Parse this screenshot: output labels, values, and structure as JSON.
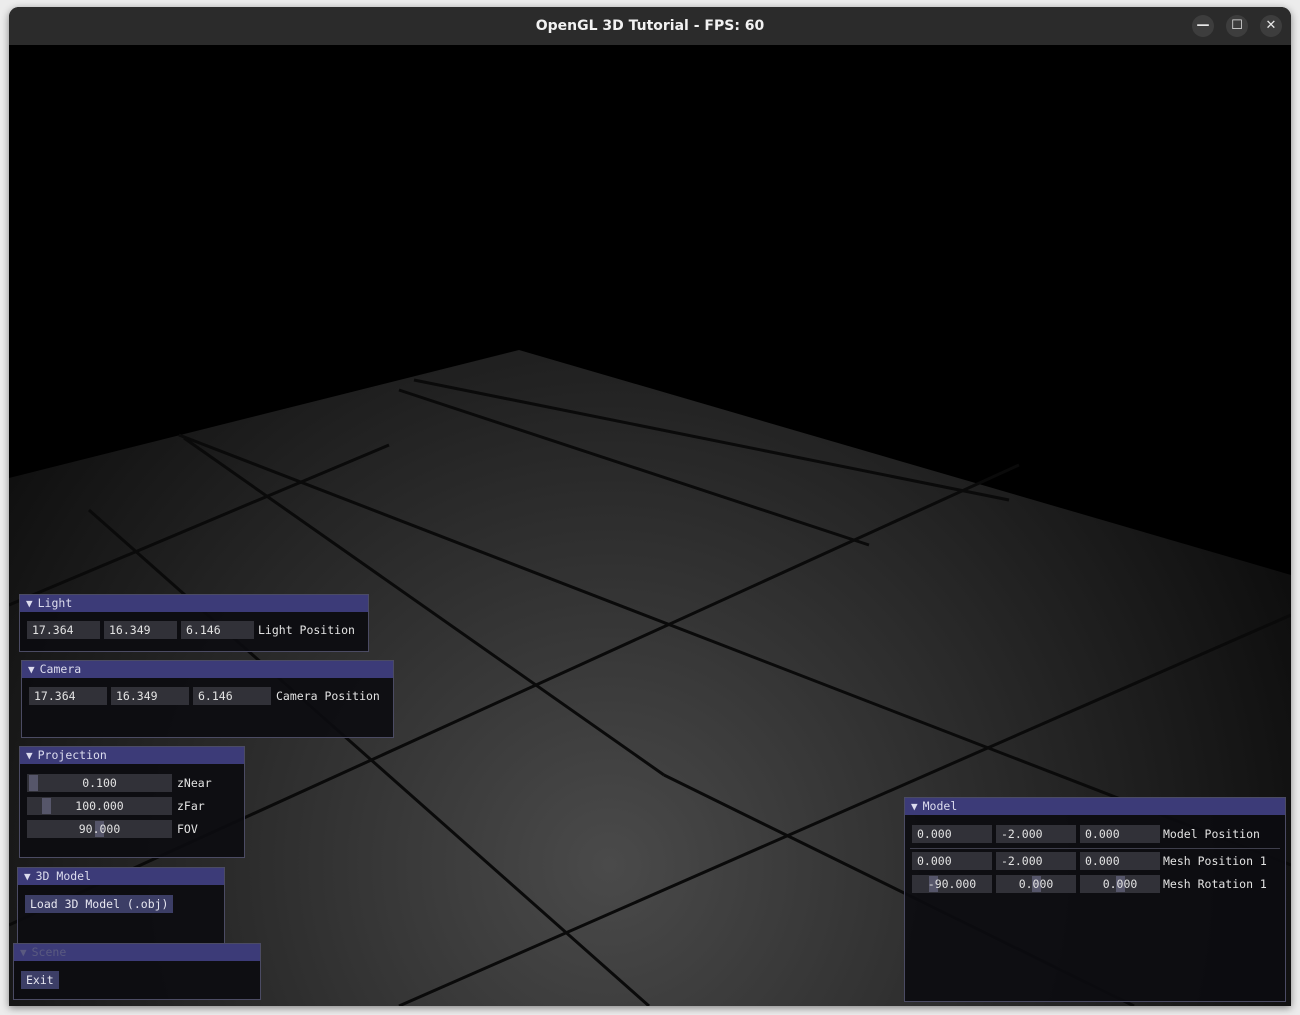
{
  "window": {
    "title": "OpenGL 3D Tutorial - FPS: 60",
    "buttons": {
      "minimize": "—",
      "maximize": "☐",
      "close": "✕"
    }
  },
  "panels": {
    "light": {
      "title": "Light",
      "position": [
        "17.364",
        "16.349",
        "6.146"
      ],
      "position_label": "Light Position"
    },
    "camera": {
      "title": "Camera",
      "position": [
        "17.364",
        "16.349",
        "6.146"
      ],
      "position_label": "Camera Position"
    },
    "projection": {
      "title": "Projection",
      "znear": {
        "value": "0.100",
        "label": "zNear"
      },
      "zfar": {
        "value": "100.000",
        "label": "zFar"
      },
      "fov": {
        "value": "90.000",
        "label": "FOV"
      }
    },
    "model3d": {
      "title": "3D Model",
      "load_button": "Load 3D Model (.obj)"
    },
    "scene": {
      "title": "Scene",
      "exit_button": "Exit"
    },
    "model": {
      "title": "Model",
      "model_position": [
        "0.000",
        "-2.000",
        "0.000"
      ],
      "model_position_label": "Model Position",
      "mesh_position": [
        "0.000",
        "-2.000",
        "0.000"
      ],
      "mesh_position_label": "Mesh Position 1",
      "mesh_rotation": [
        "-90.000",
        "0.000",
        "0.000"
      ],
      "mesh_rotation_label": "Mesh Rotation 1"
    }
  },
  "colors": {
    "panel_header": "#3c3b78",
    "field_bg": "#313138",
    "button_bg": "#3c3e66",
    "titlebar_bg": "#2b2b2b"
  }
}
